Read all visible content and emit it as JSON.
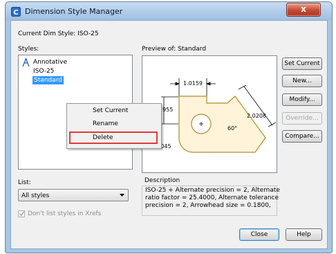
{
  "window": {
    "title": "Dimension Style Manager",
    "close_glyph": "x",
    "accent": "#a7c6e6",
    "app_icon": "autocad-dimstyle-icon"
  },
  "labels": {
    "current_dim_style": "Current Dim Style: ISO-25",
    "styles": "Styles:",
    "preview_of": "Preview of: Standard",
    "list": "List:",
    "description": "Description",
    "dont_list": "Don't list styles in Xrefs"
  },
  "styles_list": {
    "items": [
      "Annotative",
      "ISO-25",
      "Standard"
    ],
    "selected": "Standard"
  },
  "context_menu": {
    "items": [
      "Set Current",
      "Rename",
      "Delete"
    ],
    "highlighted": "Delete",
    "highlight_color": "#e03a3a"
  },
  "list_select": {
    "value": "All styles"
  },
  "buttons": {
    "set_current": "Set Current",
    "new": "New...",
    "modify": "Modify...",
    "override": "Override...",
    "compare": "Compare...",
    "close": "Close",
    "help": "Help"
  },
  "preview": {
    "dim_top": "1.0159",
    "dim_left": "1955",
    "dim_right": "2.0208",
    "angle": "60°",
    "radius": "R0.8045",
    "shape_color": "#b28a2c"
  },
  "description_text": {
    "line1": "ISO-25 + Alternate precision = 2, Alternate",
    "line2": "ratio factor = 25.4000, Alternate tolerance",
    "line3": "precision = 2, Arrowhead size = 0.1800,"
  }
}
